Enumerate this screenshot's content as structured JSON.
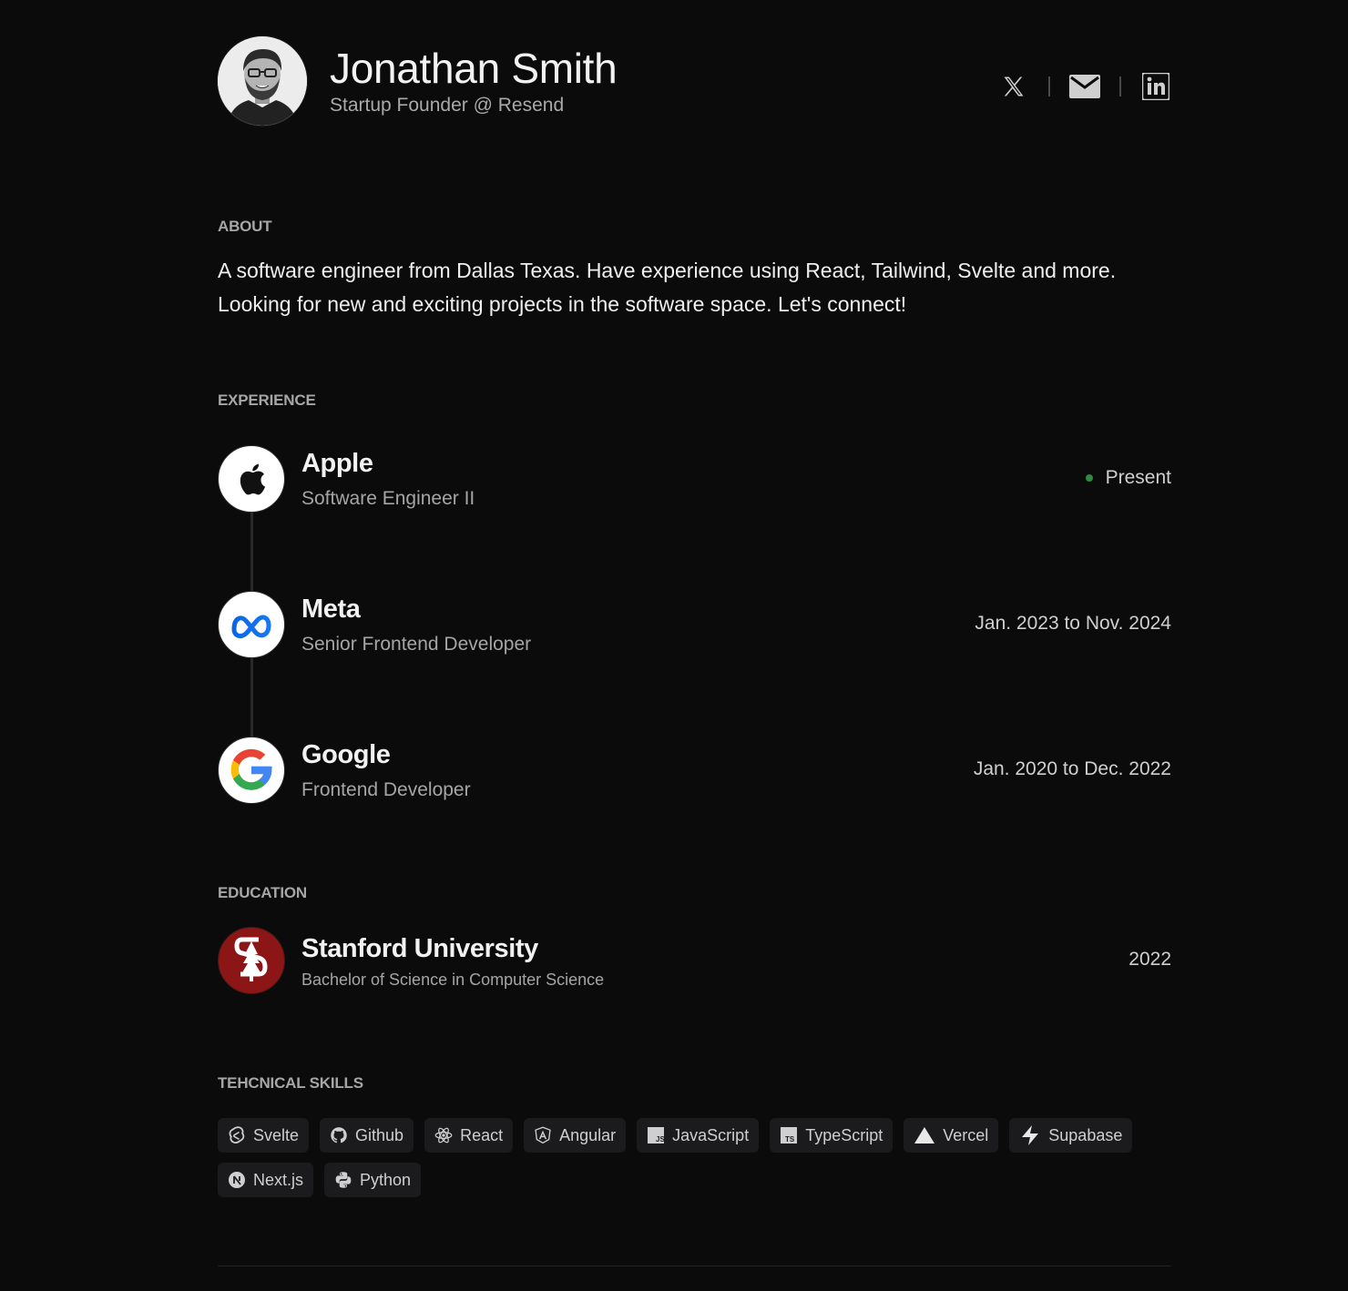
{
  "profile": {
    "name": "Jonathan Smith",
    "tagline": "Startup Founder @ Resend"
  },
  "socials": [
    {
      "icon": "x-logo-icon"
    },
    {
      "icon": "mail-icon"
    },
    {
      "icon": "linkedin-icon"
    }
  ],
  "about": {
    "title": "ABOUT",
    "text": "A software engineer from Dallas Texas. Have experience using React, Tailwind, Svelte and more. Looking for new and exciting projects in the software space. Let's connect!"
  },
  "experience": {
    "title": "EXPERIENCE",
    "jobs": [
      {
        "company": "Apple",
        "role": "Software Engineer II",
        "date": "Present",
        "icon": "apple-logo-icon",
        "current": true
      },
      {
        "company": "Meta",
        "role": "Senior Frontend Developer",
        "date": "Jan. 2023 to Nov. 2024",
        "icon": "meta-logo-icon"
      },
      {
        "company": "Google",
        "role": "Frontend Developer",
        "date": "Jan. 2020 to Dec. 2022",
        "icon": "google-logo-icon"
      }
    ],
    "present_dot_color": "#2e8b3c"
  },
  "education": {
    "title": "EDUCATION",
    "school": "Stanford University",
    "degree": "Bachelor of Science in Computer Science",
    "year": "2022",
    "icon": "stanford-logo-icon",
    "brand_color": "#8c1515"
  },
  "skills": {
    "title": "TEHCNICAL SKILLS",
    "items": [
      {
        "label": "Svelte",
        "icon": "svelte-icon"
      },
      {
        "label": "Github",
        "icon": "github-icon"
      },
      {
        "label": "React",
        "icon": "react-icon"
      },
      {
        "label": "Angular",
        "icon": "angular-icon"
      },
      {
        "label": "JavaScript",
        "icon": "javascript-icon"
      },
      {
        "label": "TypeScript",
        "icon": "typescript-icon"
      },
      {
        "label": "Vercel",
        "icon": "vercel-icon"
      },
      {
        "label": "Supabase",
        "icon": "supabase-icon"
      },
      {
        "label": "Next.js",
        "icon": "nextjs-icon"
      },
      {
        "label": "Python",
        "icon": "python-icon"
      }
    ]
  },
  "colors": {
    "background": "#0b0b0c",
    "chip_background": "#1b1b1d",
    "muted_text": "#a5a5a5"
  }
}
